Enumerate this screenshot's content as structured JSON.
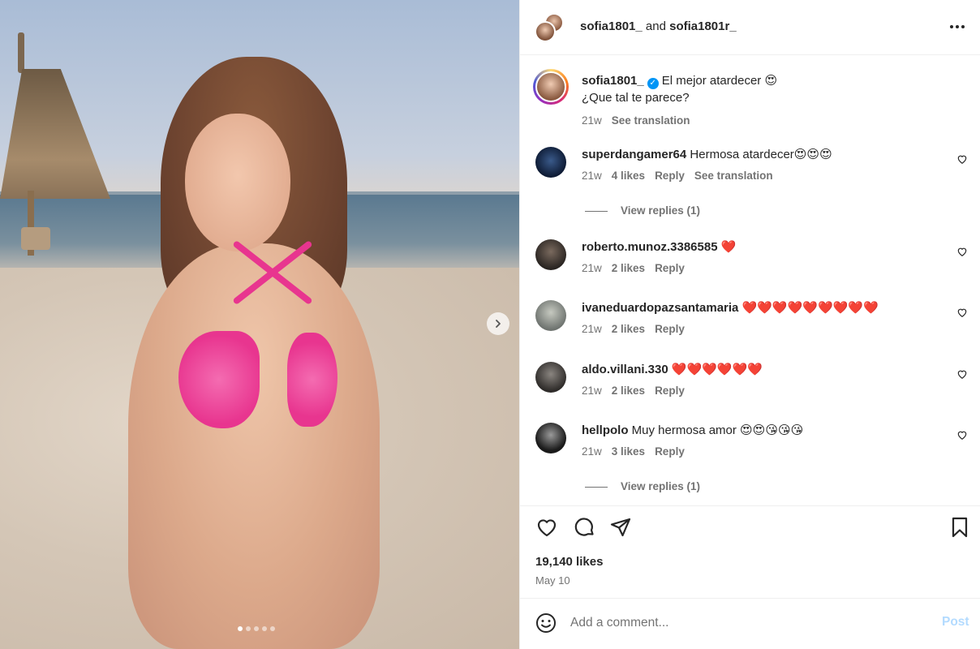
{
  "header": {
    "user1": "sofia1801_",
    "connector": "and",
    "user2": "sofia1801r_",
    "more_icon": "more-horizontal-icon"
  },
  "caption": {
    "username": "sofia1801_",
    "text_line1": "El mejor atardecer 😍",
    "text_line2": "¿Que tal te parece?",
    "time": "21w",
    "translate": "See translation"
  },
  "comments": [
    {
      "username": "superdangamer64",
      "text": "Hermosa atardecer😍😍😍",
      "time": "21w",
      "likes": "4 likes",
      "reply": "Reply",
      "translate": "See translation",
      "view_replies": "View replies (1)",
      "avatar_color": "#1a2a4a"
    },
    {
      "username": "roberto.munoz.3386585",
      "text": "❤️",
      "time": "21w",
      "likes": "2 likes",
      "reply": "Reply",
      "avatar_color": "#3a3532"
    },
    {
      "username": "ivaneduardopazsantamaria",
      "text": "❤️❤️❤️❤️❤️❤️❤️❤️❤️",
      "time": "21w",
      "likes": "2 likes",
      "reply": "Reply",
      "avatar_color": "#8a8f86"
    },
    {
      "username": "aldo.villani.330",
      "text": "❤️❤️❤️❤️❤️❤️",
      "time": "21w",
      "likes": "2 likes",
      "reply": "Reply",
      "avatar_color": "#4a4744"
    },
    {
      "username": "hellpolo",
      "text": "Muy hermosa amor 😍😍😘😘😘",
      "time": "21w",
      "likes": "3 likes",
      "reply": "Reply",
      "view_replies": "View replies (1)",
      "avatar_color": "#2a2a2a"
    }
  ],
  "stats": {
    "likes": "19,140 likes",
    "date": "May 10"
  },
  "composer": {
    "placeholder": "Add a comment...",
    "post_label": "Post"
  },
  "carousel": {
    "slides": 5,
    "active_index": 0
  },
  "colors": {
    "verified": "#0095f6",
    "post_disabled": "#b3dbff",
    "muted": "#737373"
  }
}
